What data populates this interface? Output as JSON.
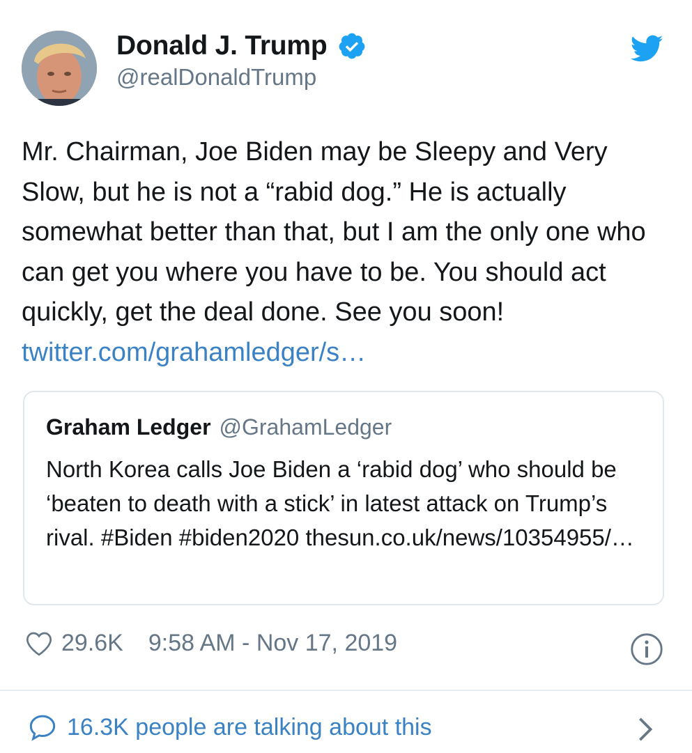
{
  "author": {
    "display_name": "Donald J. Trump",
    "handle": "@realDonaldTrump",
    "verified": true
  },
  "tweet": {
    "text": "Mr. Chairman, Joe Biden may be Sleepy and Very Slow, but he is not a “rabid dog.” He is actually somewhat better than that, but I am the only one who can get you where you have to be. You should act quickly, get the deal done. See you soon! ",
    "link": "twitter.com/grahamledger/s…"
  },
  "quoted_tweet": {
    "name": "Graham Ledger",
    "handle": "@GrahamLedger",
    "text": "North Korea calls Joe Biden a ‘rabid dog’ who should be ‘beaten to death with a stick’ in latest attack on Trump’s rival. #Biden #biden2020 thesun.co.uk/news/10354955/…"
  },
  "meta": {
    "likes": "29.6K",
    "timestamp": "9:58 AM - Nov 17, 2019"
  },
  "footer": {
    "talking": "16.3K people are talking about this"
  },
  "colors": {
    "link": "#3b82c4",
    "verified": "#1da1f2",
    "twitter_bird": "#1da1f2",
    "secondary_text": "#657786"
  },
  "icons": [
    "verified-badge-icon",
    "twitter-bird-icon",
    "heart-icon",
    "info-icon",
    "speech-bubble-icon",
    "chevron-right-icon"
  ]
}
